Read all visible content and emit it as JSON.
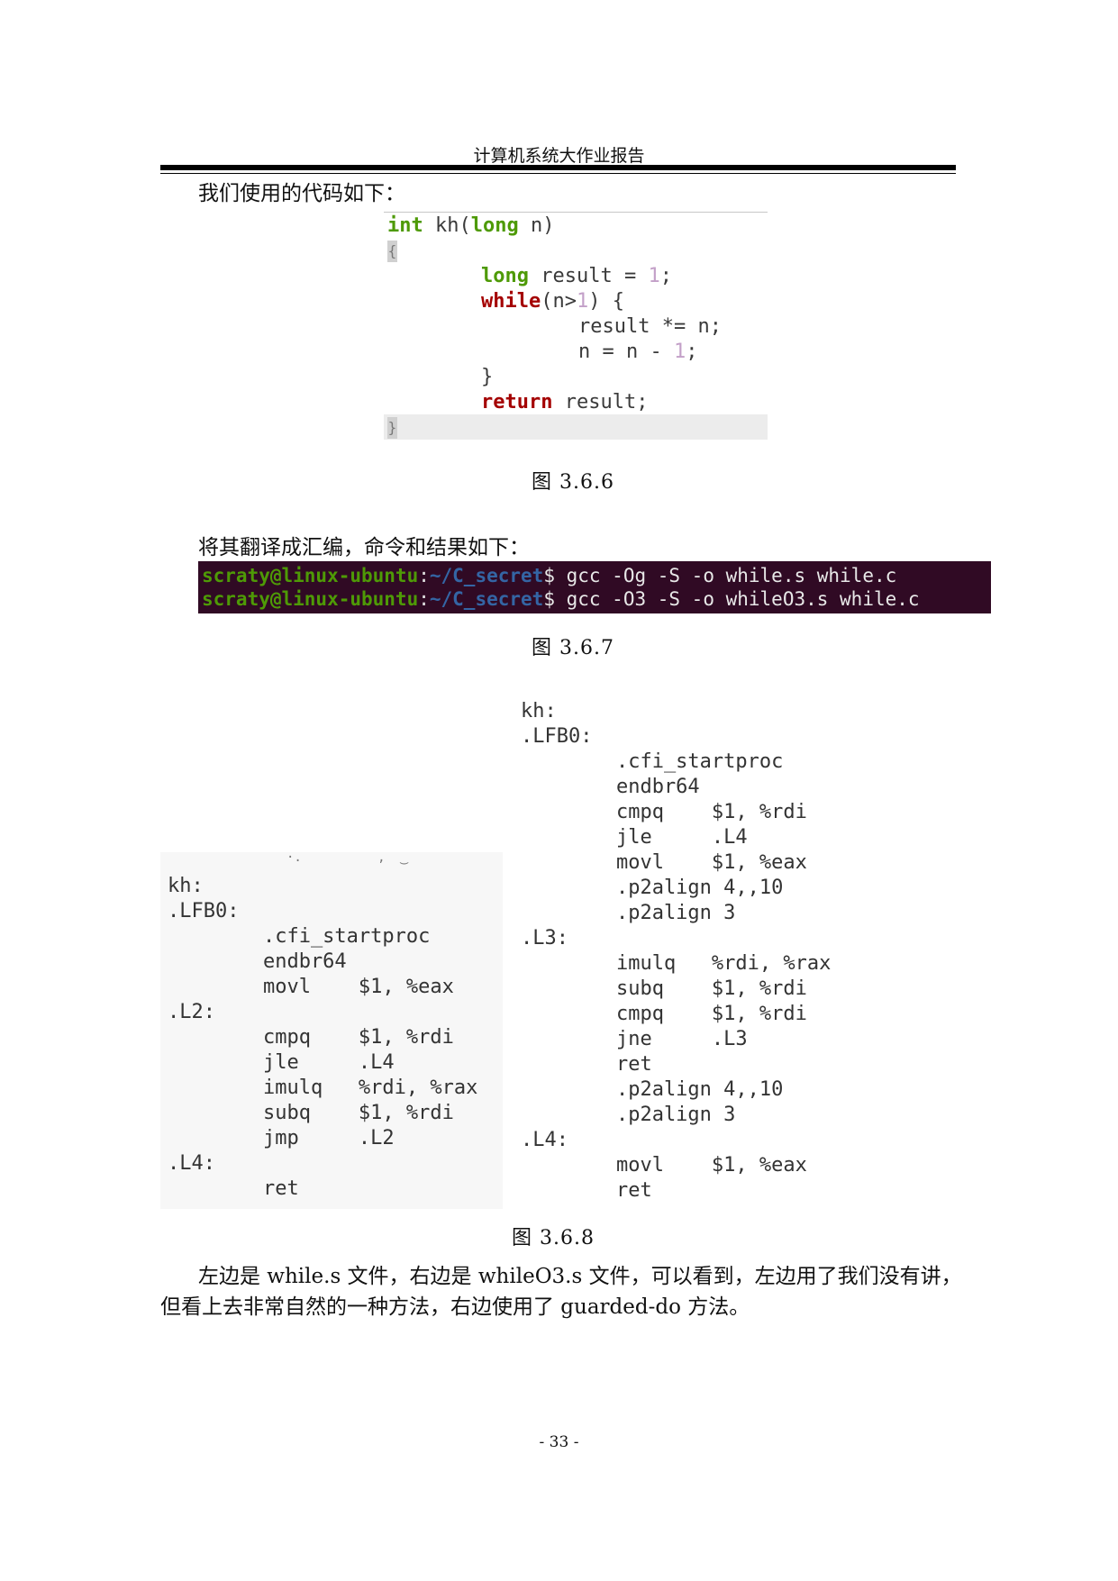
{
  "header": {
    "title": "计算机系统大作业报告"
  },
  "intro_text": "我们使用的代码如下：",
  "code": {
    "line1": {
      "type": "int",
      "rest": " kh(",
      "type2": "long",
      "tail": " n)"
    },
    "open_brace": "{",
    "line3": {
      "type": "long",
      "rest": " result = ",
      "num": "1",
      "tail": ";"
    },
    "line4": {
      "kw": "while",
      "rest": "(n>",
      "num": "1",
      "tail": ") {"
    },
    "line5": "result *= n;",
    "line6": {
      "rest": "n = n - ",
      "num": "1",
      "tail": ";"
    },
    "line7": "}",
    "line8": {
      "kw": "return",
      "tail": " result;"
    },
    "close_brace": "}"
  },
  "figure1_caption": "图 3.6.6",
  "translate_text": "将其翻译成汇编，命令和结果如下：",
  "terminal": {
    "line1": {
      "user": "scraty@linux-ubuntu",
      "colon": ":",
      "path": "~/C_secret",
      "cmd": "$ gcc -Og -S -o while.s while.c"
    },
    "line2": {
      "user": "scraty@linux-ubuntu",
      "colon": ":",
      "path": "~/C_secret",
      "cmd": "$ gcc -O3 -S -o whileO3.s while.c"
    }
  },
  "figure2_caption": "图 3.6.7",
  "asm_left": {
    "fragment": "·.          ,  ‿",
    "lines": [
      "kh:",
      ".LFB0:",
      "        .cfi_startproc",
      "        endbr64",
      "        movl    $1, %eax",
      ".L2:",
      "        cmpq    $1, %rdi",
      "        jle     .L4",
      "        imulq   %rdi, %rax",
      "        subq    $1, %rdi",
      "        jmp     .L2",
      ".L4:",
      "        ret"
    ]
  },
  "asm_right": {
    "lines": [
      "kh:",
      ".LFB0:",
      "        .cfi_startproc",
      "        endbr64",
      "        cmpq    $1, %rdi",
      "        jle     .L4",
      "        movl    $1, %eax",
      "        .p2align 4,,10",
      "        .p2align 3",
      ".L3:",
      "        imulq   %rdi, %rax",
      "        subq    $1, %rdi",
      "        cmpq    $1, %rdi",
      "        jne     .L3",
      "        ret",
      "        .p2align 4,,10",
      "        .p2align 3",
      ".L4:",
      "        movl    $1, %eax",
      "        ret"
    ]
  },
  "figure3_caption": "图 3.6.8",
  "conclusion_line1": "左边是 while.s 文件，右边是 whileO3.s 文件，可以看到，左边用了我们没有讲，",
  "conclusion_line2": "但看上去非常自然的一种方法，右边使用了 guarded-do 方法。",
  "page_number": "- 33 -"
}
